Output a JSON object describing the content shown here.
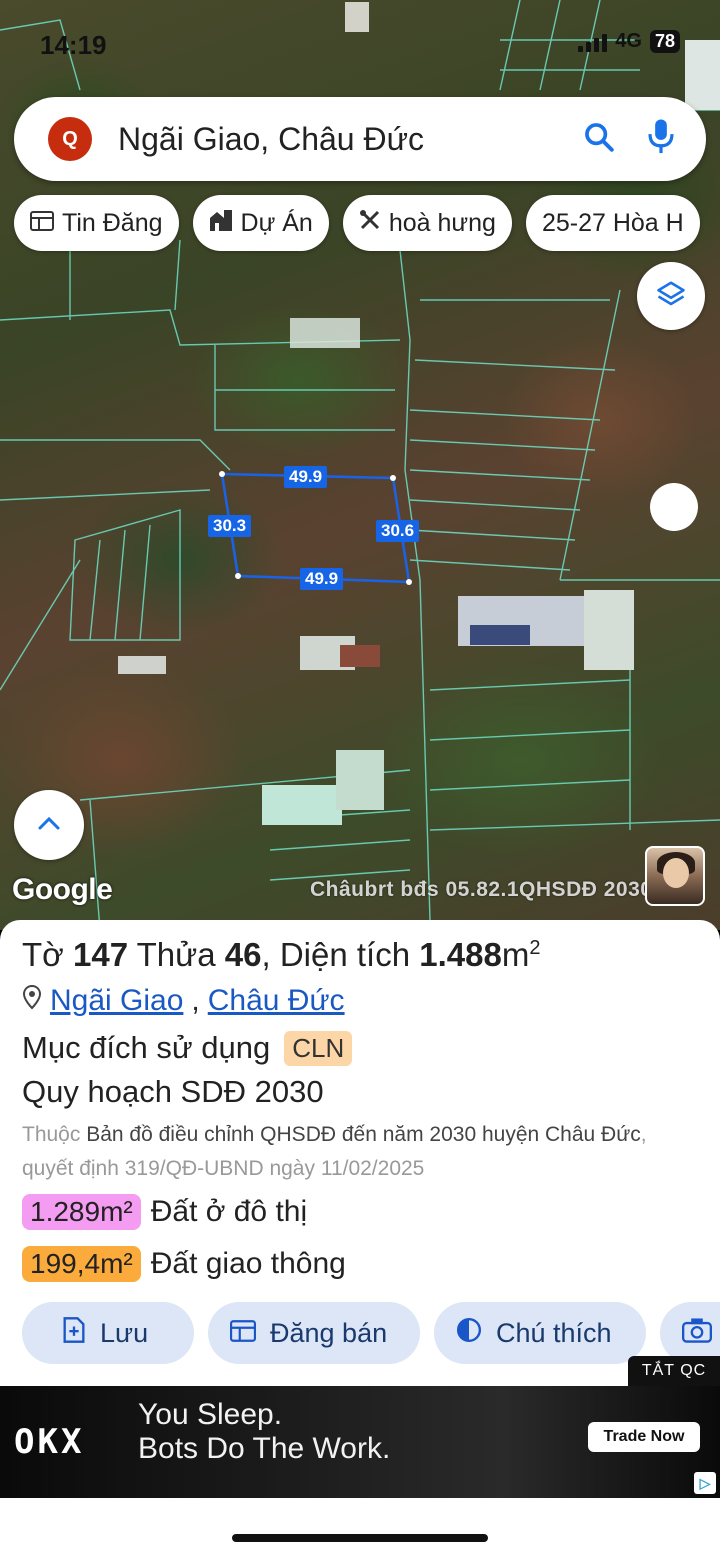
{
  "status_bar": {
    "time": "14:19",
    "network": "4G",
    "battery": "78"
  },
  "search": {
    "avatar_letter": "Q",
    "text": "Ngãi Giao, Châu Đức"
  },
  "chips": [
    {
      "label": "Tin Đăng",
      "icon": "listing-icon"
    },
    {
      "label": "Dự Án",
      "icon": "building-icon"
    },
    {
      "label": "hoà hưng",
      "icon": "tools-icon"
    },
    {
      "label": "25-27 Hòa H",
      "icon": ""
    }
  ],
  "map": {
    "dimensions": {
      "top": "49.9",
      "left": "30.3",
      "right": "30.6",
      "bottom": "49.9"
    },
    "google_logo": "Google",
    "watermark": "Châubrt bđs 05.82.1QHSDĐ 2030"
  },
  "parcel": {
    "label_sheet": "Tờ",
    "sheet": "147",
    "label_lot": "Thửa",
    "lot": "46",
    "label_area": "Diện tích",
    "area": "1.488",
    "area_unit": "m",
    "area_exp": "2",
    "ward": "Ngãi Giao",
    "district": "Châu Đức",
    "purpose_label": "Mục đích sử dụng",
    "purpose_code": "CLN",
    "plan_title": "Quy hoạch SDĐ 2030",
    "desc_prefix": "Thuộc",
    "desc_main": "Bản đồ điều chỉnh QHSDĐ đến năm 2030 huyện Châu Đức",
    "desc_suffix": ", quyết định 319/QĐ-UBND ngày 11/02/2025",
    "zones": [
      {
        "area": "1.289m²",
        "label": "Đất ở đô thị",
        "color": "#f49cf2"
      },
      {
        "area": "199,4m²",
        "label": "Đất giao thông",
        "color": "#fbab3c"
      }
    ]
  },
  "actions": [
    {
      "label": "Lưu",
      "icon": "save-icon"
    },
    {
      "label": "Đăng bán",
      "icon": "post-icon"
    },
    {
      "label": "Chú thích",
      "icon": "legend-icon"
    },
    {
      "label": "",
      "icon": "camera-icon"
    }
  ],
  "ad": {
    "close_label": "TẮT QC",
    "logo": "OKX",
    "line1": "You Sleep.",
    "line2": "Bots Do The Work.",
    "cta": "Trade Now"
  }
}
